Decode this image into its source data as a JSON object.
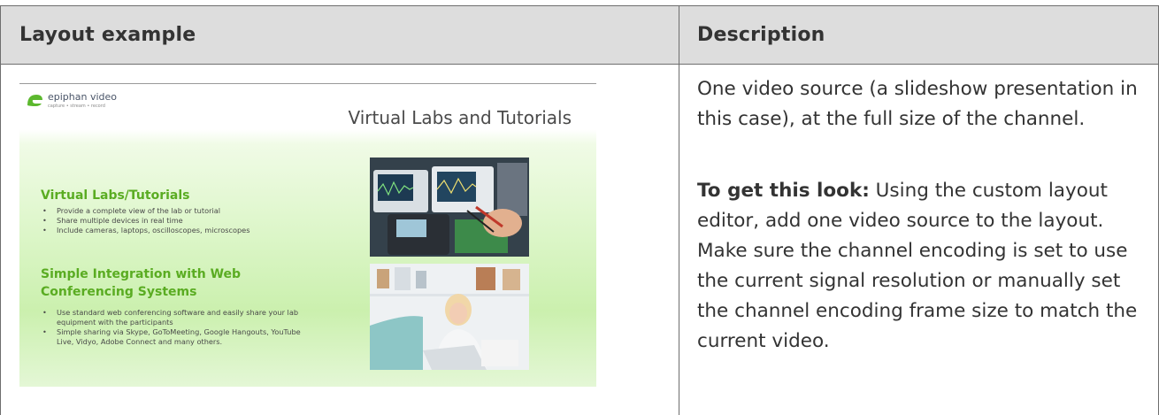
{
  "table": {
    "headers": [
      "Layout example",
      "Description"
    ]
  },
  "slide": {
    "logo_name": "epiphan video",
    "logo_tagline": "capture • stream • record",
    "title": "Virtual Labs and Tutorials",
    "section1": {
      "heading": "Virtual Labs/Tutorials",
      "bullets": [
        "Provide a complete view of the lab or tutorial",
        "Share multiple devices in real time",
        "Include cameras, laptops, oscilloscopes, microscopes"
      ]
    },
    "section2": {
      "heading": "Simple Integration with Web Conferencing Systems",
      "bullets": [
        "Use standard web conferencing software and easily share your lab equipment with the participants",
        "Simple sharing via Skype, GoToMeeting, Google Hangouts, YouTube Live, Vidyo, Adobe Connect and many others."
      ]
    },
    "colors": {
      "heading": "#5aac22",
      "logo": "#5cb82e"
    }
  },
  "description": {
    "paragraph1": "One video source (a slideshow presentation in this case), at the full size of the channel.",
    "paragraph2_label": "To get this look:",
    "paragraph2_text": " Using the custom layout editor, add one video source to the layout. Make sure the channel encoding is set to use the current signal resolution or manually set the channel encoding frame size to match the current video."
  }
}
